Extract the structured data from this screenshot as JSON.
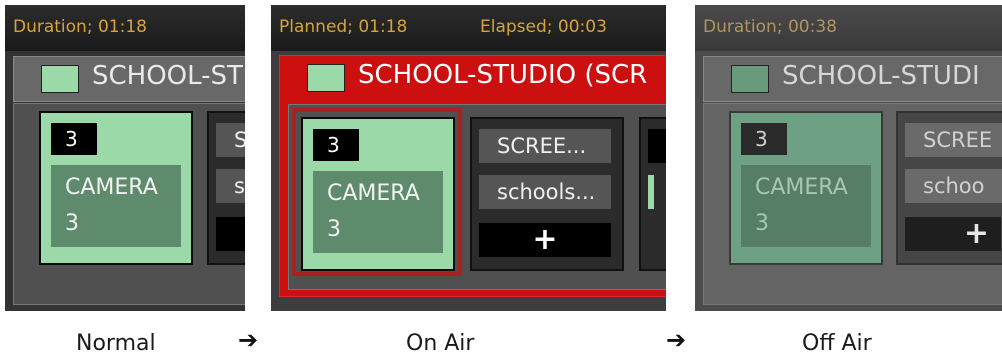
{
  "panels": {
    "normal": {
      "header": {
        "duration": "Duration; 01:18"
      },
      "group_title": "SCHOOL-ST",
      "camera": {
        "number": "3",
        "label_line1": "CAMERA",
        "label_line2": "3"
      },
      "card2": {
        "pill1": "S",
        "pill2": "s"
      }
    },
    "on_air": {
      "header": {
        "planned": "Planned; 01:18",
        "elapsed": "Elapsed; 00:03"
      },
      "group_title": "SCHOOL-STUDIO (SCR",
      "camera": {
        "number": "3",
        "label_line1": "CAMERA",
        "label_line2": "3"
      },
      "card2": {
        "pill1": "SCREE...",
        "pill2": "schools...",
        "plus": "+"
      }
    },
    "off_air": {
      "header": {
        "duration": "Duration; 00:38"
      },
      "group_title": "SCHOOL-STUDI",
      "camera": {
        "number": "3",
        "label_line1": "CAMERA",
        "label_line2": "3"
      },
      "card2": {
        "pill1": "SCREE",
        "pill2": "schoo",
        "plus": "+"
      }
    }
  },
  "captions": {
    "normal": "Normal",
    "on_air": "On Air",
    "off_air": "Off Air"
  },
  "arrows": {
    "first": "➔",
    "second": "➔"
  },
  "colors": {
    "on_air_red": "#cc1010",
    "camera_green": "#9cd9a8",
    "header_text": "#d7a43a"
  }
}
